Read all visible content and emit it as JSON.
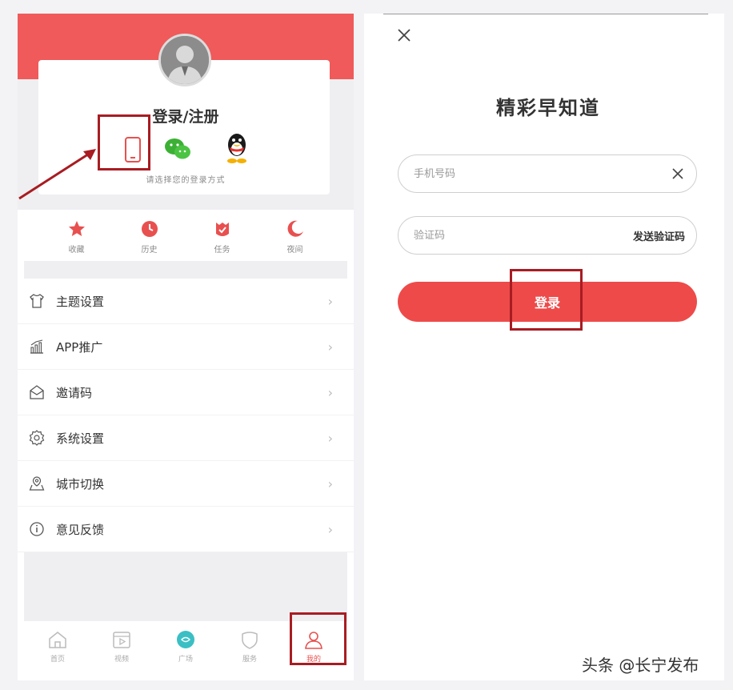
{
  "left": {
    "profile": {
      "title": "登录/注册",
      "hint": "请选择您的登录方式"
    },
    "shortcuts": [
      {
        "icon": "star-icon",
        "label": "收藏"
      },
      {
        "icon": "clock-icon",
        "label": "历史"
      },
      {
        "icon": "task-icon",
        "label": "任务"
      },
      {
        "icon": "moon-icon",
        "label": "夜间"
      }
    ],
    "menu": [
      {
        "icon": "shirt-icon",
        "label": "主题设置"
      },
      {
        "icon": "chart-icon",
        "label": "APP推广"
      },
      {
        "icon": "envelope-icon",
        "label": "邀请码"
      },
      {
        "icon": "gear-icon",
        "label": "系统设置"
      },
      {
        "icon": "location-icon",
        "label": "城市切换"
      },
      {
        "icon": "info-icon",
        "label": "意见反馈"
      }
    ],
    "menu_arrow": "›",
    "tabs": [
      {
        "icon": "home-icon",
        "label": "首页"
      },
      {
        "icon": "video-icon",
        "label": "视频"
      },
      {
        "icon": "square-icon",
        "label": "广场"
      },
      {
        "icon": "service-icon",
        "label": "服务"
      },
      {
        "icon": "user-icon",
        "label": "我的"
      }
    ]
  },
  "right": {
    "title": "精彩早知道",
    "phone_placeholder": "手机号码",
    "code_placeholder": "验证码",
    "send_code": "发送验证码",
    "login_button": "登录"
  },
  "watermark": "头条 @长宁发布",
  "colors": {
    "accent": "#ee4a4a",
    "header": "#f05a5a",
    "highlight": "#a81c22"
  }
}
